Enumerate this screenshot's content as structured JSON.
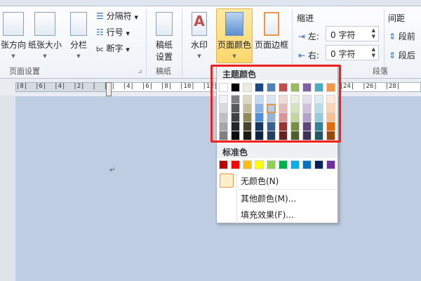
{
  "ribbon": {
    "page_setup": {
      "label": "页面设置",
      "orientation": "张方向",
      "size": "纸张大小",
      "columns": "分栏",
      "breaks": "分隔符",
      "line_numbers": "行号",
      "hyphenation": "断字"
    },
    "manuscript": {
      "label": "稿纸",
      "setup_line1": "稿纸",
      "setup_line2": "设置"
    },
    "background": {
      "watermark": "水印",
      "page_color": "页面颜色",
      "page_borders": "页面边框"
    },
    "paragraph": {
      "label": "段落",
      "indent": "缩进",
      "left_label": "左:",
      "left_value": "0 字符",
      "right_label": "右:",
      "right_value": "0 字符",
      "spacing": "间距",
      "before": "段前",
      "after": "段后"
    }
  },
  "ruler": {
    "labels": "|8|  |6|  |4|  |2|  |  |2|  |4|  |6|  |8|  |10|  |12|  |14|  |16|  |18|  |20|  |22|  |24|  |26|  |28|"
  },
  "document": {
    "paragraph_mark": "↵"
  },
  "color_menu": {
    "theme_title": "主题颜色",
    "theme_colors": [
      "#FFFFFF",
      "#000000",
      "#EEECE1",
      "#1F497D",
      "#4F81BD",
      "#C0504D",
      "#9BBB59",
      "#8064A2",
      "#4BACC6",
      "#F79646"
    ],
    "theme_shades": [
      [
        "#F2F2F2",
        "#D9D9D9",
        "#BFBFBF",
        "#A6A6A6",
        "#808080"
      ],
      [
        "#7F7F7F",
        "#595959",
        "#3F3F3F",
        "#262626",
        "#0D0D0D"
      ],
      [
        "#DDD9C3",
        "#C4BD97",
        "#938953",
        "#494429",
        "#1D1B10"
      ],
      [
        "#C6D9F0",
        "#8DB3E2",
        "#548DD4",
        "#17365D",
        "#0F243E"
      ],
      [
        "#DBE5F1",
        "#B8CCE4",
        "#95B3D7",
        "#366092",
        "#244061"
      ],
      [
        "#F2DCDB",
        "#E5B9B7",
        "#D99694",
        "#953734",
        "#632423"
      ],
      [
        "#EBF1DD",
        "#D7E3BC",
        "#C3D69B",
        "#76923C",
        "#4F6128"
      ],
      [
        "#E5E0EC",
        "#CCC1D9",
        "#B2A2C7",
        "#5F497A",
        "#3F3151"
      ],
      [
        "#DBEEF3",
        "#B7DDE8",
        "#92CDDC",
        "#31859B",
        "#205867"
      ],
      [
        "#FDEADA",
        "#FBD5B5",
        "#FAC08F",
        "#E36C09",
        "#974806"
      ]
    ],
    "selected": {
      "column": 4,
      "shade": 1
    },
    "standard_title": "标准色",
    "standard_colors": [
      "#C00000",
      "#FF0000",
      "#FFC000",
      "#FFFF00",
      "#92D050",
      "#00B050",
      "#00B0F0",
      "#0070C0",
      "#002060",
      "#7030A0"
    ],
    "no_color": "无颜色(N)",
    "more_colors": "其他颜色(M)...",
    "fill_effects": "填充效果(F)...",
    "highlight_color": "#F0201C"
  }
}
